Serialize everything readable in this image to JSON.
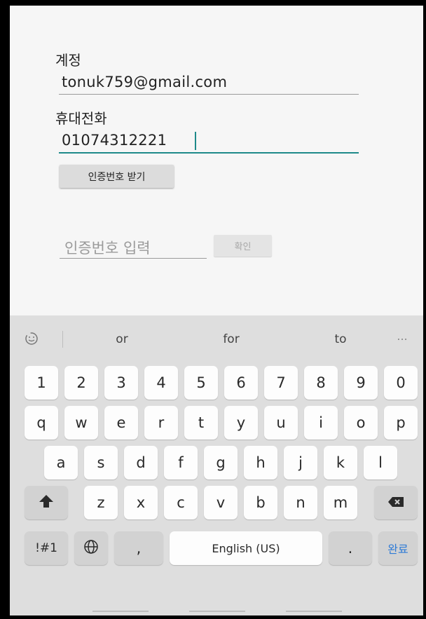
{
  "form": {
    "account_label": "계정",
    "account_value": "tonuk759@gmail.com",
    "phone_label": "휴대전화",
    "phone_value": "01074312221",
    "get_code_button": "인증번호 받기",
    "code_placeholder": "인증번호 입력",
    "confirm_button": "확인"
  },
  "keyboard": {
    "emoji_icon": "emoji-icon",
    "suggestions": [
      "or",
      "for",
      "to"
    ],
    "more_icon": "...",
    "number_row": [
      "1",
      "2",
      "3",
      "4",
      "5",
      "6",
      "7",
      "8",
      "9",
      "0"
    ],
    "row1": [
      "q",
      "w",
      "e",
      "r",
      "t",
      "y",
      "u",
      "i",
      "o",
      "p"
    ],
    "row2": [
      "a",
      "s",
      "d",
      "f",
      "g",
      "h",
      "j",
      "k",
      "l"
    ],
    "row3": [
      "z",
      "x",
      "c",
      "v",
      "b",
      "n",
      "m"
    ],
    "symbols_key": "!#1",
    "comma_key": ",",
    "space_key": "English (US)",
    "period_key": ".",
    "done_key": "완료"
  },
  "colors": {
    "accent": "#1e8a8a",
    "done_key": "#2f7bd6"
  }
}
